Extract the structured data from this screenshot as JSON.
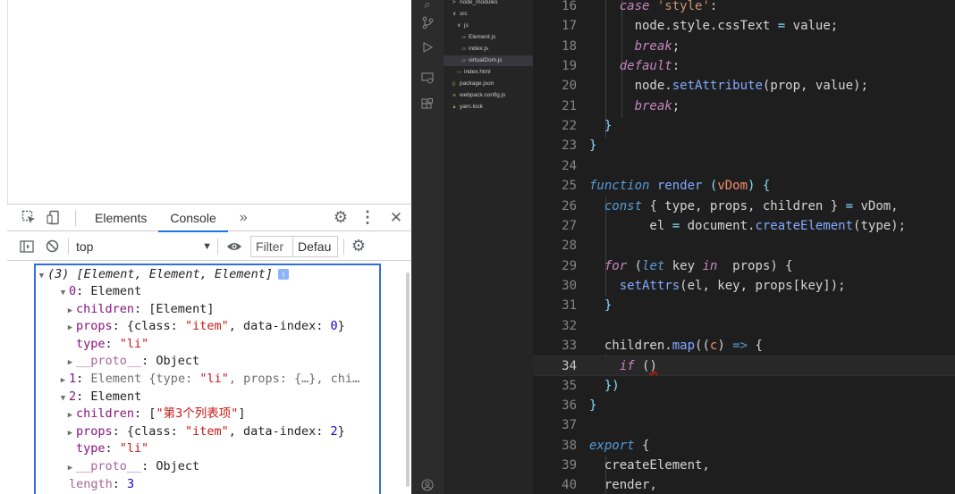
{
  "devtools": {
    "tabs": [
      "Elements",
      "Console"
    ],
    "active_tab": "Console",
    "more_tabs_glyph": "»",
    "context": "top",
    "filter_label": "Filter",
    "levels_label": "Defau",
    "icons": [
      "inspect-element-icon",
      "device-toolbar-icon",
      "settings-gear-icon",
      "more-vert-icon",
      "close-icon",
      "sidebar-toggle-icon",
      "clear-console-icon",
      "live-expression-eye-icon"
    ]
  },
  "console": {
    "summary": "(3) [Element, Element, Element]",
    "info": "i",
    "lines": [
      {
        "arrow": "▾",
        "key": "0",
        "sep": ": ",
        "value": "Element"
      },
      {
        "arrow": "▸",
        "key": "children",
        "sep": ": ",
        "value": "[Element]"
      },
      {
        "arrow": "▸",
        "key": "props",
        "sep": ": ",
        "value_pre": "{class: ",
        "value_str": "\"item\"",
        "value_mid": ", data-index: ",
        "value_num": "0",
        "value_post": "}"
      },
      {
        "arrow": "",
        "key": "type",
        "sep": ": ",
        "value_str": "\"li\""
      },
      {
        "arrow": "▸",
        "key": "__proto__",
        "sep": ": ",
        "value": "Object"
      },
      {
        "arrow": "▸",
        "key": "1",
        "sep": ": ",
        "value_pre": "Element {type: ",
        "value_str": "\"li\"",
        "value_post": ", props: {…}, chi…"
      },
      {
        "arrow": "▾",
        "key": "2",
        "sep": ": ",
        "value": "Element"
      },
      {
        "arrow": "▸",
        "key": "children",
        "sep": ": ",
        "value_pre": "[",
        "value_str": "\"第3个列表项\"",
        "value_post": "]"
      },
      {
        "arrow": "▸",
        "key": "props",
        "sep": ": ",
        "value_pre": "{class: ",
        "value_str": "\"item\"",
        "value_mid": ", data-index: ",
        "value_num": "2",
        "value_post": "}"
      },
      {
        "arrow": "",
        "key": "type",
        "sep": ": ",
        "value_str": "\"li\""
      },
      {
        "arrow": "▸",
        "key": "__proto__",
        "sep": ": ",
        "value": "Object"
      },
      {
        "arrow": "",
        "key": "length",
        "sep": ": ",
        "value_num": "3"
      }
    ]
  },
  "explorer": {
    "items": [
      {
        "label": "node_modules",
        "arrow": ">",
        "level": 0
      },
      {
        "label": "src",
        "arrow": "∨",
        "level": 0
      },
      {
        "label": "js",
        "arrow": "∨",
        "level": 1
      },
      {
        "label": "Element.js",
        "icon": "JS",
        "level": 2
      },
      {
        "label": "index.js",
        "icon": "JS",
        "level": 2
      },
      {
        "label": "virtualDom.js",
        "icon": "JS",
        "level": 2,
        "selected": true
      },
      {
        "label": "index.html",
        "icon": "<>",
        "level": 1
      },
      {
        "label": "package.json",
        "icon": "{}",
        "level": 0
      },
      {
        "label": "webpack.config.js",
        "icon": "⚙",
        "level": 0
      },
      {
        "label": "yarn.lock",
        "icon": "♟",
        "level": 0
      }
    ]
  },
  "editor": {
    "current_line": 34,
    "lines": [
      {
        "n": 16,
        "tokens": [
          [
            "    ",
            "t-var"
          ],
          [
            "case",
            "t-kw"
          ],
          [
            " ",
            "t-var"
          ],
          [
            "'style'",
            "t-str"
          ],
          [
            ":",
            "t-punc"
          ]
        ]
      },
      {
        "n": 17,
        "tokens": [
          [
            "      node",
            "t-var"
          ],
          [
            ".",
            "t-punc"
          ],
          [
            "style",
            "t-var"
          ],
          [
            ".",
            "t-punc"
          ],
          [
            "cssText",
            "t-var"
          ],
          [
            " = ",
            "t-op"
          ],
          [
            "value",
            "t-var"
          ],
          [
            ";",
            "t-punc"
          ]
        ]
      },
      {
        "n": 18,
        "tokens": [
          [
            "      ",
            "t-var"
          ],
          [
            "break",
            "t-kw"
          ],
          [
            ";",
            "t-punc"
          ]
        ]
      },
      {
        "n": 19,
        "tokens": [
          [
            "    ",
            "t-var"
          ],
          [
            "default",
            "t-kw"
          ],
          [
            ":",
            "t-punc"
          ]
        ]
      },
      {
        "n": 20,
        "tokens": [
          [
            "      node",
            "t-var"
          ],
          [
            ".",
            "t-punc"
          ],
          [
            "setAttribute",
            "t-fn2"
          ],
          [
            "(prop, value);",
            "t-var"
          ]
        ]
      },
      {
        "n": 21,
        "tokens": [
          [
            "      ",
            "t-var"
          ],
          [
            "break",
            "t-kw"
          ],
          [
            ";",
            "t-punc"
          ]
        ]
      },
      {
        "n": 22,
        "tokens": [
          [
            "  }",
            "t-brace"
          ]
        ]
      },
      {
        "n": 23,
        "tokens": [
          [
            "}",
            "t-brace"
          ]
        ]
      },
      {
        "n": 24,
        "tokens": [
          [
            "",
            "t-var"
          ]
        ]
      },
      {
        "n": 25,
        "tokens": [
          [
            "function",
            "t-kw2"
          ],
          [
            " ",
            "t-var"
          ],
          [
            "render",
            "t-fn2"
          ],
          [
            " ",
            "t-var"
          ],
          [
            "(",
            "t-brace"
          ],
          [
            "vDom",
            "t-param"
          ],
          [
            ")",
            "t-brace"
          ],
          [
            " {",
            "t-brace"
          ]
        ]
      },
      {
        "n": 26,
        "tokens": [
          [
            "  ",
            "t-var"
          ],
          [
            "const",
            "t-kw2"
          ],
          [
            " { type, props, children } ",
            "t-var"
          ],
          [
            "=",
            "t-op"
          ],
          [
            " vDom,",
            "t-var"
          ]
        ]
      },
      {
        "n": 27,
        "tokens": [
          [
            "        el ",
            "t-var"
          ],
          [
            "=",
            "t-op"
          ],
          [
            " document",
            "t-var"
          ],
          [
            ".",
            "t-punc"
          ],
          [
            "createElement",
            "t-fn2"
          ],
          [
            "(type);",
            "t-var"
          ]
        ]
      },
      {
        "n": 28,
        "tokens": [
          [
            "",
            "t-var"
          ]
        ]
      },
      {
        "n": 29,
        "tokens": [
          [
            "  ",
            "t-var"
          ],
          [
            "for",
            "t-kw"
          ],
          [
            " (",
            "t-var"
          ],
          [
            "let",
            "t-kw2"
          ],
          [
            " key ",
            "t-var"
          ],
          [
            "in",
            "t-kw"
          ],
          [
            "  props) {",
            "t-var"
          ]
        ]
      },
      {
        "n": 30,
        "tokens": [
          [
            "    ",
            "t-var"
          ],
          [
            "setAttrs",
            "t-fn2"
          ],
          [
            "(el, key, props[key]);",
            "t-var"
          ]
        ]
      },
      {
        "n": 31,
        "tokens": [
          [
            "  }",
            "t-brace"
          ]
        ]
      },
      {
        "n": 32,
        "tokens": [
          [
            "",
            "t-var"
          ]
        ]
      },
      {
        "n": 33,
        "tokens": [
          [
            "  children",
            "t-var"
          ],
          [
            ".",
            "t-punc"
          ],
          [
            "map",
            "t-fn2"
          ],
          [
            "((",
            "t-var"
          ],
          [
            "c",
            "t-param"
          ],
          [
            ") ",
            "t-var"
          ],
          [
            "=>",
            "t-kw2"
          ],
          [
            " {",
            "t-var"
          ]
        ]
      },
      {
        "n": 34,
        "tokens": [
          [
            "    ",
            "t-var"
          ],
          [
            "if",
            "t-kw"
          ],
          [
            " (",
            "t-var"
          ],
          [
            ")",
            "t-var"
          ]
        ]
      },
      {
        "n": 35,
        "tokens": [
          [
            "  })",
            "t-brace"
          ]
        ]
      },
      {
        "n": 36,
        "tokens": [
          [
            "}",
            "t-brace"
          ]
        ]
      },
      {
        "n": 37,
        "tokens": [
          [
            "",
            "t-var"
          ]
        ]
      },
      {
        "n": 38,
        "tokens": [
          [
            "export",
            "t-kw2"
          ],
          [
            " {",
            "t-var"
          ]
        ]
      },
      {
        "n": 39,
        "tokens": [
          [
            "  createElement,",
            "t-var"
          ]
        ]
      },
      {
        "n": 40,
        "tokens": [
          [
            "  render,",
            "t-var"
          ]
        ]
      }
    ]
  }
}
